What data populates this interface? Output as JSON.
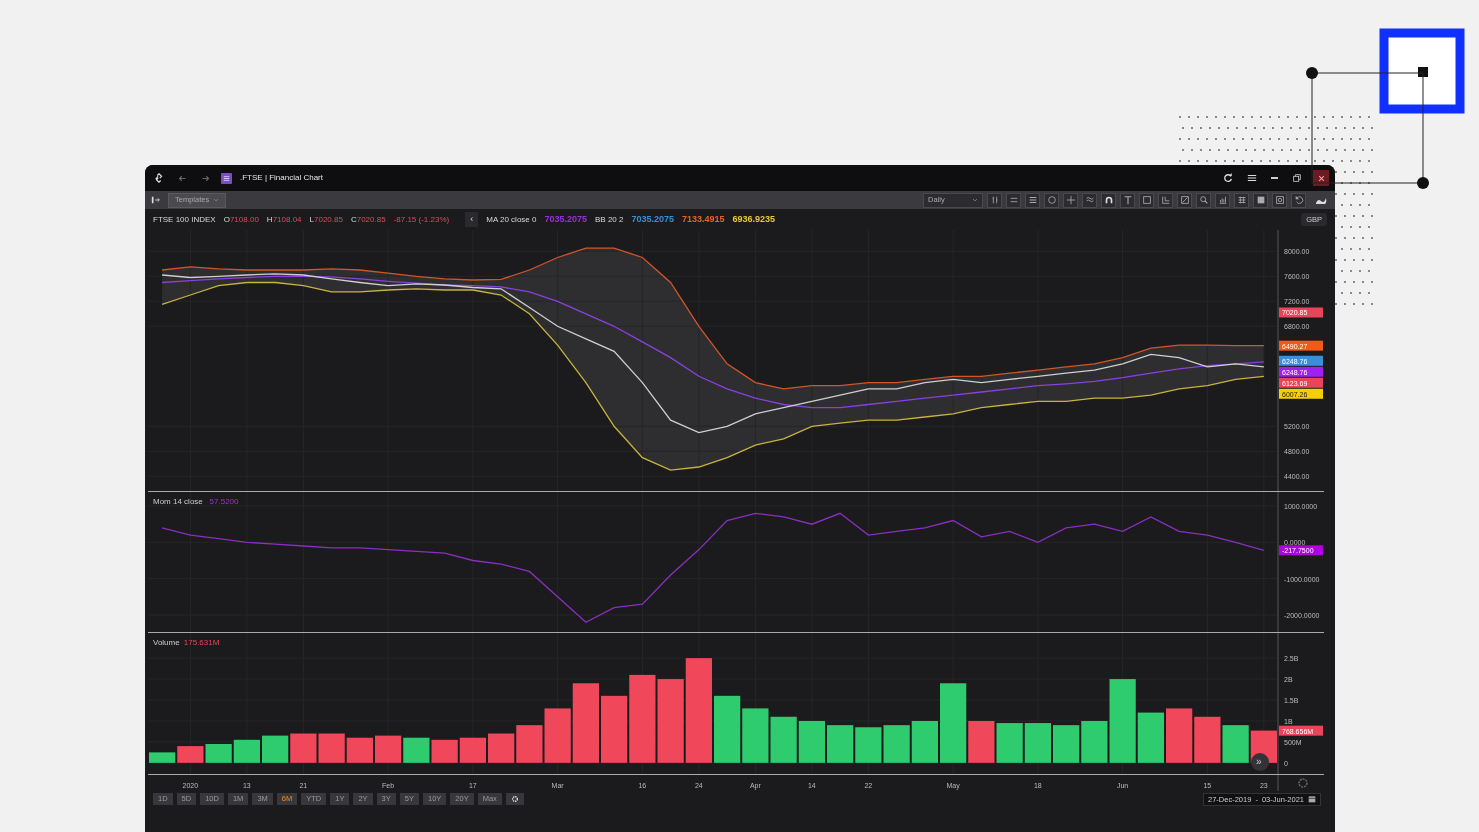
{
  "window": {
    "title": ".FTSE | Financial Chart"
  },
  "toolbar": {
    "templates": "Templates",
    "interval": "Daily"
  },
  "legend": {
    "instrument": "FTSE 100 INDEX",
    "ohlc": [
      {
        "key": "O",
        "value": "7108.00"
      },
      {
        "key": "H",
        "value": "7108.04"
      },
      {
        "key": "L",
        "value": "7020.85"
      },
      {
        "key": "C",
        "value": "7020.85"
      }
    ],
    "change": "-87.15 (-1.23%)",
    "collapse": "‹",
    "studies": [
      {
        "name": "MA 20 close 0",
        "values": [
          {
            "text": "7035.2075",
            "color": "#9b30d9"
          }
        ]
      },
      {
        "name": "BB 20 2",
        "values": [
          {
            "text": "7035.2075",
            "color": "#3a8fd0"
          },
          {
            "text": "7133.4915",
            "color": "#e8622c"
          },
          {
            "text": "6936.9235",
            "color": "#e8c93a"
          }
        ]
      }
    ]
  },
  "currency": "GBP",
  "price_panel": {
    "tags": [
      {
        "text": "7020.85",
        "color": "#e8455a"
      },
      {
        "text": "6490.27",
        "color": "#f25a1a"
      },
      {
        "text": "6248.76",
        "color": "#3b8fd6"
      },
      {
        "text": "6248.76",
        "color": "#a020f0"
      },
      {
        "text": "6123.69",
        "color": "#e8455a"
      },
      {
        "text": "6007.26",
        "color": "#f5d000"
      }
    ],
    "band": {
      "color": "#2e2e31"
    },
    "chart_data": {
      "type": "line",
      "grid": true,
      "ylim": [
        4150,
        8340
      ],
      "yticks": [
        {
          "value": 8000,
          "label": "8000.00"
        },
        {
          "value": 7600,
          "label": "7600.00"
        },
        {
          "value": 7200,
          "label": "7200.00"
        },
        {
          "value": 6800,
          "label": "6800.00"
        },
        {
          "value": 5200,
          "label": "5200.00"
        },
        {
          "value": 4800,
          "label": "4800.00"
        },
        {
          "value": 4400,
          "label": "4400.00"
        }
      ],
      "series": [
        {
          "color": "#d2552a",
          "values": [
            7700,
            7750,
            7720,
            7700,
            7700,
            7700,
            7720,
            7700,
            7650,
            7600,
            7560,
            7540,
            7550,
            7700,
            7900,
            8050,
            8050,
            7900,
            7500,
            6800,
            6200,
            5900,
            5800,
            5850,
            5850,
            5900,
            5900,
            5950,
            6000,
            6000,
            6050,
            6100,
            6150,
            6200,
            6300,
            6450,
            6500,
            6500,
            6490,
            6490
          ]
        },
        {
          "color": "#c8b43a",
          "values": [
            7150,
            7300,
            7450,
            7500,
            7500,
            7450,
            7350,
            7350,
            7380,
            7400,
            7380,
            7380,
            7300,
            7000,
            6500,
            5900,
            5200,
            4700,
            4500,
            4550,
            4700,
            4900,
            5000,
            5200,
            5250,
            5300,
            5300,
            5350,
            5400,
            5500,
            5550,
            5600,
            5600,
            5650,
            5650,
            5700,
            5800,
            5850,
            5950,
            6000
          ]
        },
        {
          "color": "#8a3fe0",
          "values": [
            7500,
            7530,
            7560,
            7580,
            7600,
            7600,
            7590,
            7560,
            7520,
            7490,
            7460,
            7450,
            7430,
            7350,
            7200,
            7000,
            6800,
            6550,
            6300,
            6000,
            5800,
            5650,
            5550,
            5500,
            5500,
            5550,
            5600,
            5650,
            5700,
            5750,
            5800,
            5850,
            5880,
            5920,
            5980,
            6050,
            6120,
            6170,
            6200,
            6230
          ]
        },
        {
          "color": "#cfcfcf",
          "values": [
            7620,
            7580,
            7600,
            7620,
            7640,
            7620,
            7560,
            7500,
            7450,
            7480,
            7460,
            7420,
            7400,
            7100,
            6800,
            6600,
            6400,
            5900,
            5300,
            5100,
            5200,
            5400,
            5500,
            5600,
            5700,
            5800,
            5800,
            5900,
            5950,
            5900,
            5950,
            6000,
            6050,
            6100,
            6200,
            6350,
            6300,
            6150,
            6200,
            6150
          ]
        }
      ]
    }
  },
  "momentum_panel": {
    "title": "Mom 14 close",
    "value": "57.5200",
    "tag": {
      "text": "-217.7500",
      "color": "#b000e0"
    },
    "chart_data": {
      "type": "line",
      "grid": true,
      "ylim": [
        -2495,
        1385
      ],
      "yticks": [
        {
          "value": 1000,
          "label": "1000.0000"
        },
        {
          "value": 0,
          "label": "0.0000"
        },
        {
          "value": -1000,
          "label": "-1000.0000"
        },
        {
          "value": -2000,
          "label": "-2000.0000"
        }
      ],
      "series": [
        {
          "color": "#8a2fc0",
          "values": [
            400,
            200,
            100,
            0,
            -50,
            -100,
            -150,
            -150,
            -200,
            -250,
            -300,
            -500,
            -600,
            -800,
            -1500,
            -2200,
            -1800,
            -1700,
            -900,
            -200,
            600,
            800,
            700,
            500,
            800,
            200,
            300,
            400,
            600,
            150,
            300,
            0,
            400,
            500,
            300,
            700,
            300,
            200,
            0,
            -220
          ]
        }
      ]
    }
  },
  "volume_panel": {
    "title": "Volume",
    "value": "175.631M",
    "tag": {
      "text": "768.656M",
      "color": "#e8455a"
    },
    "scroll_button": "»",
    "chart_data": {
      "type": "bar",
      "stacked": true,
      "grid": true,
      "ylim": [
        -290000000,
        3100000000
      ],
      "yticks": [
        {
          "value": 0,
          "label": "0"
        },
        {
          "value": 500000000,
          "label": "500M"
        },
        {
          "value": 1000000000,
          "label": "1B"
        },
        {
          "value": 1500000000,
          "label": "1.5B"
        },
        {
          "value": 2000000000,
          "label": "2B"
        },
        {
          "value": 2500000000,
          "label": "2.5B"
        }
      ],
      "categories": [
        null,
        "2020",
        null,
        "13",
        null,
        "21",
        null,
        null,
        "Feb",
        null,
        null,
        "17",
        null,
        null,
        "Mar",
        null,
        null,
        "16",
        null,
        "24",
        null,
        "Apr",
        null,
        "14",
        null,
        "22",
        null,
        null,
        "May",
        null,
        null,
        "18",
        null,
        null,
        "Jun",
        null,
        null,
        "15",
        null,
        "23"
      ],
      "series": [
        {
          "color": "#2ecc6f",
          "values": [
            250000000,
            null,
            450000000,
            550000000,
            650000000,
            null,
            null,
            null,
            null,
            600000000,
            null,
            null,
            null,
            null,
            null,
            null,
            null,
            null,
            null,
            null,
            1600000000,
            1300000000,
            1100000000,
            1000000000,
            900000000,
            850000000,
            900000000,
            1000000000,
            1900000000,
            null,
            950000000,
            950000000,
            900000000,
            1000000000,
            2000000000,
            1200000000,
            null,
            null,
            900000000,
            null
          ]
        },
        {
          "color": "#f0475b",
          "values": [
            null,
            400000000,
            null,
            null,
            null,
            700000000,
            700000000,
            600000000,
            650000000,
            null,
            550000000,
            600000000,
            700000000,
            900000000,
            1300000000,
            1900000000,
            1600000000,
            2100000000,
            2000000000,
            2500000000,
            null,
            null,
            null,
            null,
            null,
            null,
            null,
            null,
            null,
            1000000000,
            null,
            null,
            null,
            null,
            null,
            null,
            1300000000,
            1100000000,
            null,
            770000000
          ]
        }
      ]
    }
  },
  "ranges": [
    {
      "label": "1D",
      "selected": false
    },
    {
      "label": "5D",
      "selected": false
    },
    {
      "label": "10D",
      "selected": false
    },
    {
      "label": "1M",
      "selected": false
    },
    {
      "label": "3M",
      "selected": false
    },
    {
      "label": "6M",
      "selected": true
    },
    {
      "label": "YTD",
      "selected": false
    },
    {
      "label": "1Y",
      "selected": false
    },
    {
      "label": "2Y",
      "selected": false
    },
    {
      "label": "3Y",
      "selected": false
    },
    {
      "label": "5Y",
      "selected": false
    },
    {
      "label": "10Y",
      "selected": false
    },
    {
      "label": "20Y",
      "selected": false
    },
    {
      "label": "Max",
      "selected": false
    }
  ],
  "date_range": {
    "from": "27-Dec-2019",
    "separator": "-",
    "to": "03-Jun-2021"
  }
}
